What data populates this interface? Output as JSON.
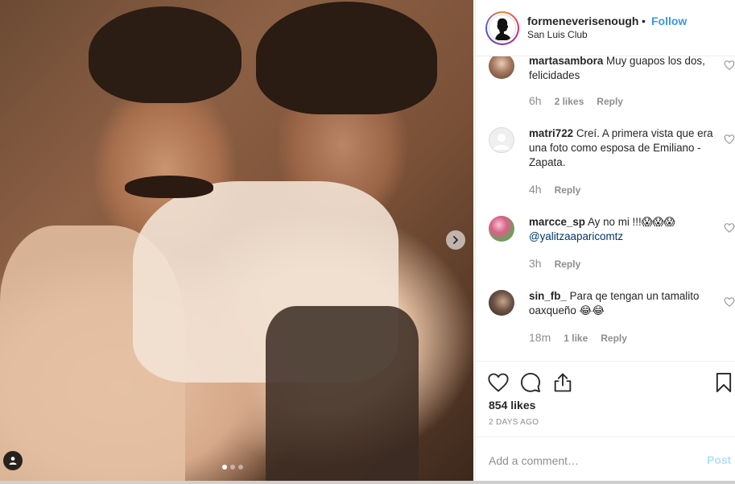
{
  "post": {
    "header": {
      "username": "formeneverisenough",
      "separator": "•",
      "follow_label": "Follow",
      "location": "San Luis Club"
    },
    "carousel": {
      "dot_count": 3,
      "active_index": 0
    },
    "icons": {
      "next": "chevron-right-icon",
      "tag": "user-tag-icon",
      "like": "heart-icon",
      "comment": "comment-bubble-icon",
      "share": "share-icon",
      "save": "bookmark-icon"
    },
    "comments": [
      {
        "username": "martasambora",
        "text": "Muy guapos los dos, felicidades",
        "mention": "",
        "time": "6h",
        "likes": "2 likes",
        "reply": "Reply"
      },
      {
        "username": "matri722",
        "text": "Creí. A primera vista que era una foto como esposa de Emiliano -Zapata.",
        "mention": "",
        "time": "4h",
        "likes": "",
        "reply": "Reply"
      },
      {
        "username": "marcce_sp",
        "text": "Ay no mi !!!😱😱😱",
        "mention": "@yalitzaaparicomtz",
        "time": "3h",
        "likes": "",
        "reply": "Reply"
      },
      {
        "username": "sin_fb_",
        "text": "Para qe tengan un tamalito oaxqueño 😂😂",
        "mention": "",
        "time": "18m",
        "likes": "1 like",
        "reply": "Reply"
      }
    ],
    "likes_label": "854 likes",
    "date_label": "2 DAYS AGO",
    "add_comment": {
      "placeholder": "Add a comment…",
      "post_label": "Post"
    },
    "colors": {
      "link_blue": "#3897f0",
      "mention_blue": "#003569",
      "muted": "#8e8e8e",
      "post_disabled": "#b2dffc"
    }
  }
}
